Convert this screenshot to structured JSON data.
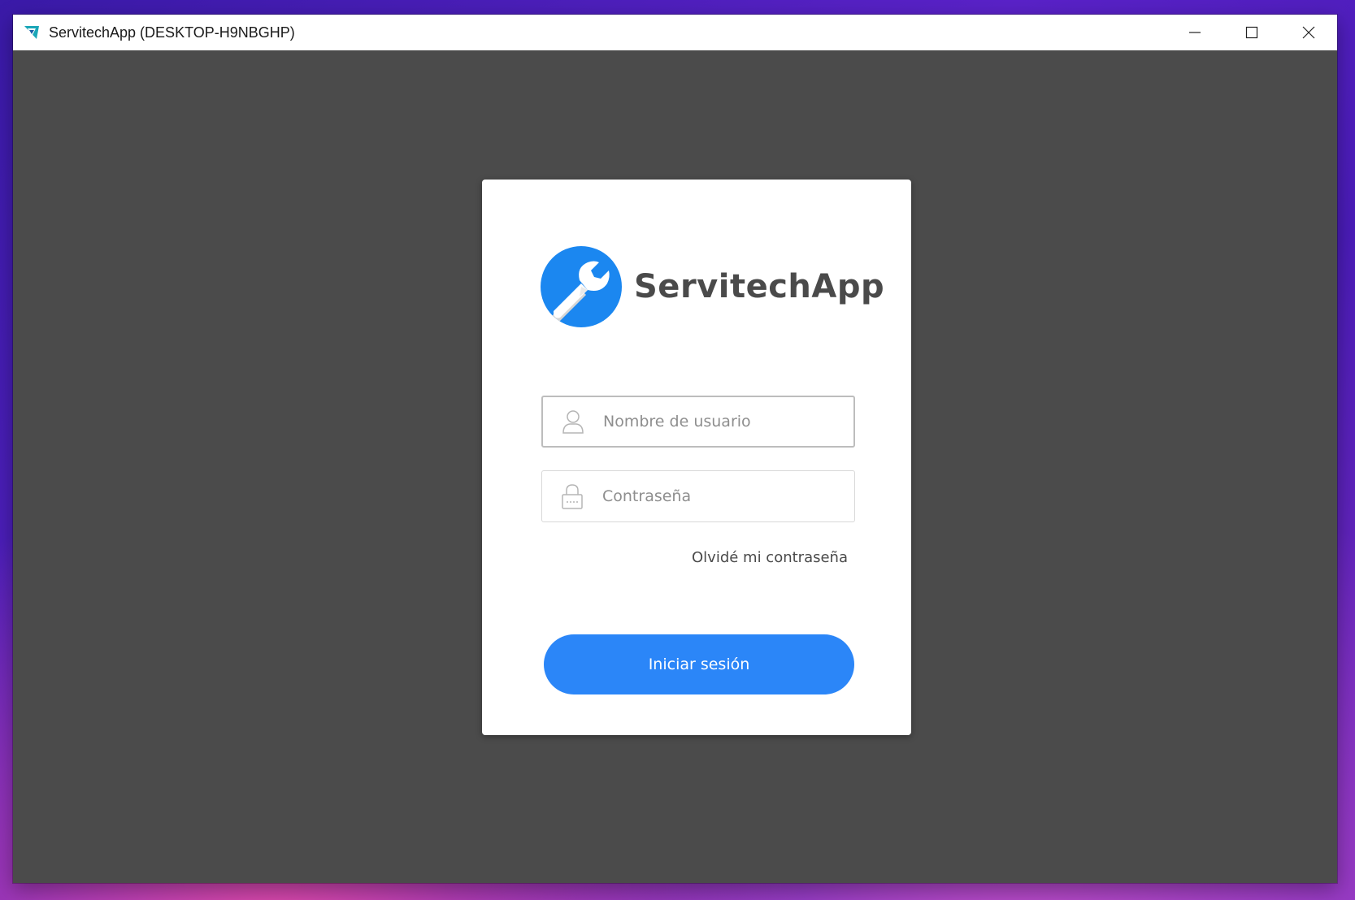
{
  "window": {
    "title": "ServitechApp (DESKTOP-H9NBGHP)",
    "app_icon": "servitech-app-icon",
    "controls": {
      "minimize": "minimize-icon",
      "maximize": "maximize-icon",
      "close": "close-icon"
    }
  },
  "login": {
    "logo_text": "ServitechApp",
    "logo_icon": "wrench-icon",
    "username": {
      "placeholder": "Nombre de usuario",
      "value": "",
      "icon": "user-icon"
    },
    "password": {
      "placeholder": "Contraseña",
      "value": "",
      "icon": "lock-icon"
    },
    "forgot_label": "Olvidé mi contraseña",
    "submit_label": "Iniciar sesión"
  },
  "colors": {
    "brand_blue": "#1b87f0",
    "button_blue": "#2b86f8",
    "background": "#4b4b4b",
    "card": "#ffffff"
  }
}
